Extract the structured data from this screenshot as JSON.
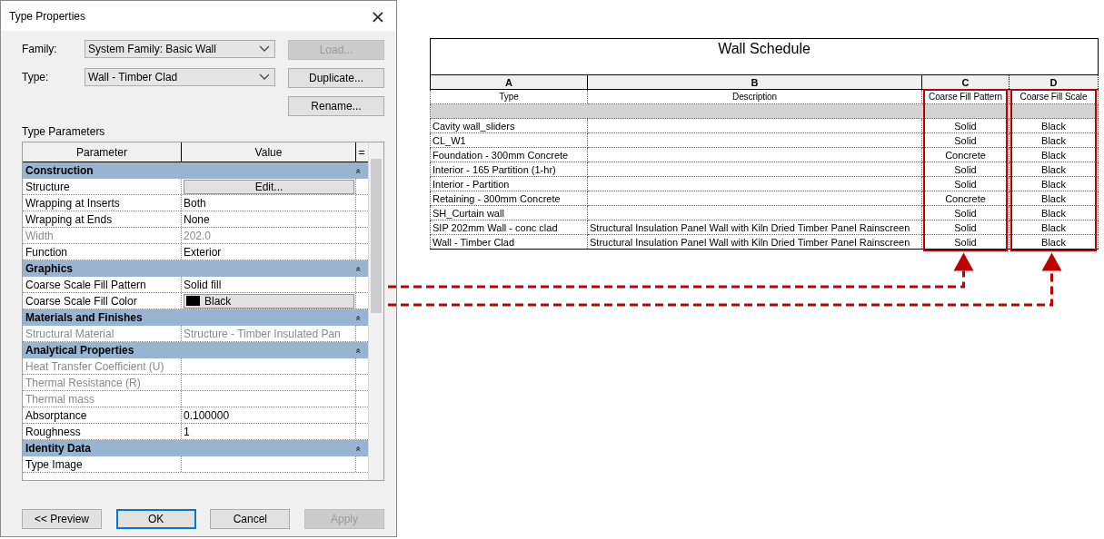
{
  "dialog": {
    "title": "Type Properties",
    "close": "×",
    "fields": [
      {
        "label": "Family:",
        "value": "System Family: Basic Wall"
      },
      {
        "label": "Type:",
        "value": "Wall - Timber Clad"
      }
    ],
    "side_buttons": [
      {
        "label": "Load...",
        "disabled": true
      },
      {
        "label": "Duplicate...",
        "disabled": false
      },
      {
        "label": "Rename...",
        "disabled": false
      }
    ],
    "section_label": "Type Parameters",
    "grid": {
      "columns": [
        "Parameter",
        "Value",
        "="
      ],
      "rows": [
        {
          "kind": "group",
          "label": "Construction",
          "toggle": "«"
        },
        {
          "kind": "button",
          "name": "Structure",
          "value": "Edit...",
          "disabled": false
        },
        {
          "kind": "text",
          "name": "Wrapping at Inserts",
          "value": "Both",
          "disabled": false
        },
        {
          "kind": "text",
          "name": "Wrapping at Ends",
          "value": "None",
          "disabled": false
        },
        {
          "kind": "text",
          "name": "Width",
          "value": "202.0",
          "disabled": true
        },
        {
          "kind": "text",
          "name": "Function",
          "value": "Exterior",
          "disabled": false
        },
        {
          "kind": "group",
          "label": "Graphics",
          "toggle": "«"
        },
        {
          "kind": "text",
          "name": "Coarse Scale Fill Pattern",
          "value": "Solid fill",
          "disabled": false
        },
        {
          "kind": "color",
          "name": "Coarse Scale Fill Color",
          "value": "Black",
          "color": "#000000",
          "disabled": false
        },
        {
          "kind": "group",
          "label": "Materials and Finishes",
          "toggle": "«"
        },
        {
          "kind": "text",
          "name": "Structural Material",
          "value": "Structure - Timber Insulated Pan",
          "disabled": true
        },
        {
          "kind": "group",
          "label": "Analytical Properties",
          "toggle": "«"
        },
        {
          "kind": "text",
          "name": "Heat Transfer Coefficient (U)",
          "disabled": true
        },
        {
          "kind": "text",
          "name": "Thermal Resistance (R)",
          "disabled": true
        },
        {
          "kind": "text",
          "name": "Thermal mass",
          "disabled": true
        },
        {
          "kind": "text",
          "name": "Absorptance",
          "value": "0.100000",
          "disabled": false
        },
        {
          "kind": "text",
          "name": "Roughness",
          "value": "1",
          "disabled": false
        },
        {
          "kind": "group",
          "label": "Identity Data",
          "toggle": "«"
        },
        {
          "kind": "text",
          "name": "Type Image",
          "disabled": false
        }
      ]
    },
    "buttons": [
      {
        "label": "<< Preview",
        "default": false,
        "disabled": false
      },
      {
        "label": "OK",
        "default": true,
        "disabled": false
      },
      {
        "label": "Cancel",
        "default": false,
        "disabled": false
      },
      {
        "label": "Apply",
        "default": false,
        "disabled": true
      }
    ]
  },
  "schedule": {
    "title": "Wall Schedule",
    "columns": [
      {
        "letter": "A",
        "heading": "Type",
        "highlighted": false
      },
      {
        "letter": "B",
        "heading": "Description",
        "highlighted": false
      },
      {
        "letter": "C",
        "heading": "Coarse Fill Pattern",
        "highlighted": true
      },
      {
        "letter": "D",
        "heading": "Coarse Fill Scale",
        "highlighted": true
      }
    ],
    "rows": [
      [
        "Cavity wall_sliders",
        "",
        "Solid",
        "Black"
      ],
      [
        "CL_W1",
        "",
        "Solid",
        "Black"
      ],
      [
        "Foundation - 300mm Concrete",
        "",
        "Concrete",
        "Black"
      ],
      [
        "Interior - 165 Partition (1-hr)",
        "",
        "Solid",
        "Black"
      ],
      [
        "Interior - Partition",
        "",
        "Solid",
        "Black"
      ],
      [
        "Retaining - 300mm Concrete",
        "",
        "Concrete",
        "Black"
      ],
      [
        "SH_Curtain wall",
        "",
        "Solid",
        "Black"
      ],
      [
        "SIP 202mm Wall - conc clad",
        "Structural Insulation Panel Wall with Kiln Dried Timber Panel Rainscreen",
        "Solid",
        "Black"
      ],
      [
        "Wall - Timber Clad",
        "Structural Insulation Panel Wall with Kiln Dried Timber Panel Rainscreen",
        "Solid",
        "Black"
      ]
    ]
  }
}
